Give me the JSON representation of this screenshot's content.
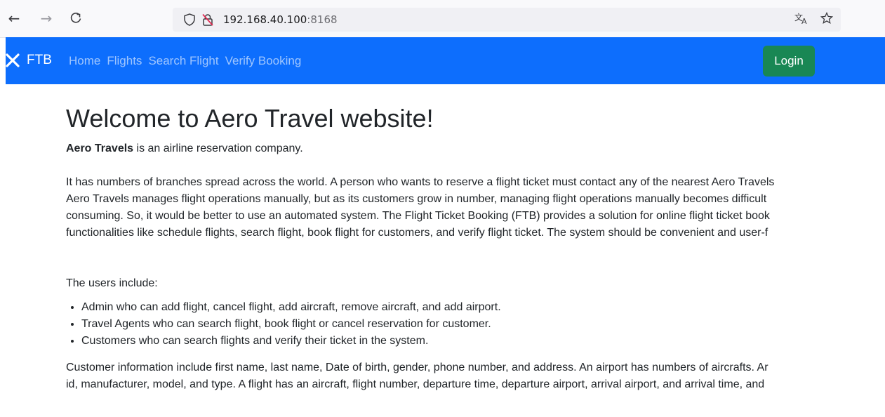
{
  "browser": {
    "url_host": "192.168.40.100",
    "url_port": ":8168"
  },
  "navbar": {
    "brand": "FTB",
    "links": [
      "Home",
      "Flights",
      "Search Flight",
      "Verify Booking"
    ],
    "login_label": "Login",
    "bg_color": "#0d6efd",
    "login_color": "#198754"
  },
  "main": {
    "title": "Welcome to Aero Travel website!",
    "intro_bold": "Aero Travels",
    "intro_rest": " is an airline reservation company.",
    "para_lines": [
      "It has numbers of branches spread across the world. A person who wants to reserve a flight ticket must contact any of the nearest Aero Travels",
      "Aero Travels manages flight operations manually, but as its customers grow in number, managing flight operations manually becomes difficult",
      "consuming. So, it would be better to use an automated system. The Flight Ticket Booking (FTB) provides a solution for online flight ticket book",
      "functionalities like schedule flights, search flight, book flight for customers, and verify flight ticket. The system should be convenient and user-f"
    ],
    "users_heading": "The users include:",
    "users": [
      "Admin who can add flight, cancel flight, add aircraft, remove aircraft, and add airport.",
      "Travel Agents who can search flight, book flight or cancel reservation for customer.",
      "Customers who can search flights and verify their ticket in the system."
    ],
    "customer_lines": [
      "Customer information include first name, last name, Date of birth, gender, phone number, and address. An airport has numbers of aircrafts. Ar",
      "id, manufacturer, model, and type. A flight has an aircraft, flight number, departure time, departure airport, arrival airport, and arrival time, and"
    ]
  }
}
